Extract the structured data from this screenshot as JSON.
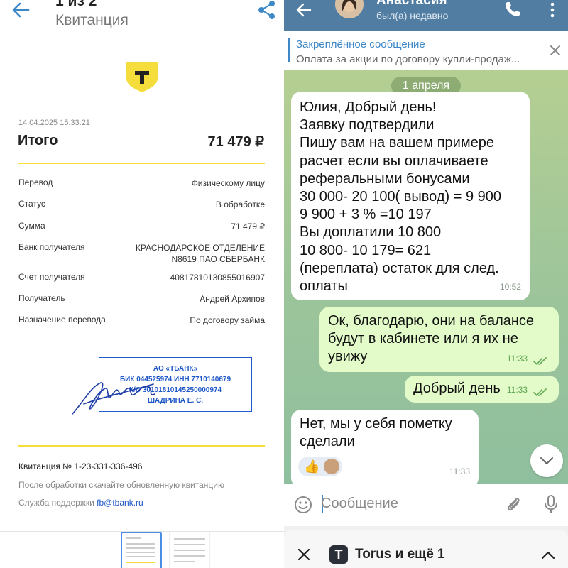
{
  "receipt": {
    "page_count": "1 из 2",
    "doc_title": "Квитанция",
    "logo_letter": "T",
    "date": "14.04.2025 15:33:21",
    "total_label": "Итого",
    "total_value": "71 479 ₽",
    "rows": [
      {
        "key": "Перевод",
        "value": "Физическому лицу"
      },
      {
        "key": "Статус",
        "value": "В обработке"
      },
      {
        "key": "Сумма",
        "value": "71 479 ₽"
      },
      {
        "key": "Банк получателя",
        "value": "КРАСНОДАРСКОЕ ОТДЕЛЕНИЕ\nN8619 ПАО СБЕРБАНК"
      },
      {
        "key": "Счет получателя",
        "value": "40817810130855016907"
      },
      {
        "key": "Получатель",
        "value": "Андрей Архипов"
      },
      {
        "key": "Назначение перевода",
        "value": "По договору займа"
      }
    ],
    "stamp_lines": [
      "АО «ТБАНК»",
      "БИК 044525974 ИНН 7710140679",
      "К/С 30101810145250000974",
      "ШАДРИНА Е. С."
    ],
    "receipt_number": "Квитанция  № 1-23-331-336-496",
    "note": "После обработки скачайте обновленную квитанцию",
    "support_label": "Служба поддержки",
    "support_email": "fb@tbank.ru",
    "colors": {
      "accent_yellow": "#f5dd3b",
      "stamp_blue": "#1f58c7"
    }
  },
  "chat": {
    "contact_name": "Анастасия",
    "contact_status": "был(а) недавно",
    "pinned_title": "Закреплённое сообщение",
    "pinned_text": "Оплата за акции по договору купли-продаж...",
    "date_divider": "1 апреля",
    "messages": [
      {
        "dir": "in",
        "text": "Юлия, Добрый день!\nЗаявку подтвердили\nПишу вам на вашем примере\nрасчет если вы оплачиваете\nреферальными бонусами\n30 000- 20 100( вывод) = 9 900\n9 900 + 3 % =10 197\nВы доплатили 10 800\n10 800- 10 179= 621\n(переплата) остаток для след.\nоплаты",
        "time": "10:52"
      },
      {
        "dir": "out",
        "text": "Ок, благодарю, они на балансе\nбудут в кабинете или я их не\nувижу",
        "time": "11:33",
        "read": true
      },
      {
        "dir": "out",
        "text": "Добрый день",
        "time": "11:33",
        "read": true
      },
      {
        "dir": "in",
        "text": "Нет, мы у себя пометку\nсделали",
        "time": "11:33",
        "reaction": "👍"
      }
    ],
    "composer_placeholder": "Сообщение",
    "tabs_label": "Torus и ещё 1",
    "tabs_app_letter": "T",
    "colors": {
      "topbar": "#527da3",
      "accent": "#3e88c7",
      "out_bubble": "#e2fbc8"
    }
  },
  "icons": [
    "back-arrow-icon",
    "share-icon",
    "phone-icon",
    "more-vert-icon",
    "close-icon",
    "emoji-icon",
    "attach-icon",
    "mic-icon",
    "chevron-down-icon",
    "chevron-up-icon",
    "double-check-icon"
  ]
}
